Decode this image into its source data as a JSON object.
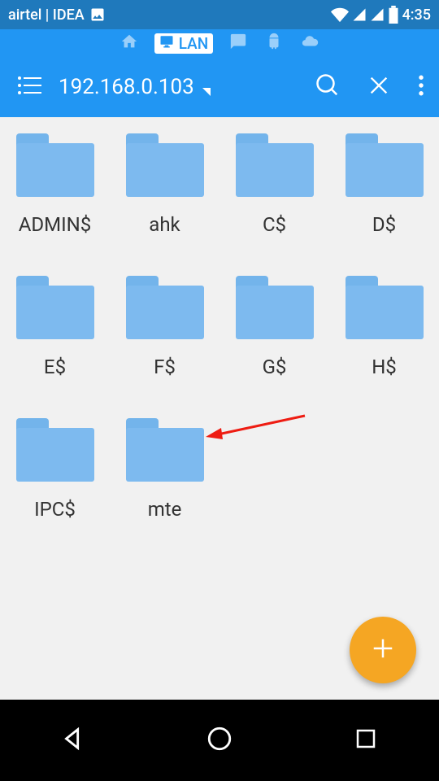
{
  "status": {
    "carrier": "airtel | IDEA",
    "time": "4:35"
  },
  "tabs": {
    "active_label": "LAN"
  },
  "toolbar": {
    "address": "192.168.0.103"
  },
  "folders": [
    {
      "label": "ADMIN$"
    },
    {
      "label": "ahk"
    },
    {
      "label": "C$"
    },
    {
      "label": "D$"
    },
    {
      "label": "E$"
    },
    {
      "label": "F$"
    },
    {
      "label": "G$"
    },
    {
      "label": "H$"
    },
    {
      "label": "IPC$"
    },
    {
      "label": "mte"
    }
  ],
  "colors": {
    "accent": "#2196f3",
    "fab": "#f5a623",
    "arrow": "#ee1c12"
  }
}
